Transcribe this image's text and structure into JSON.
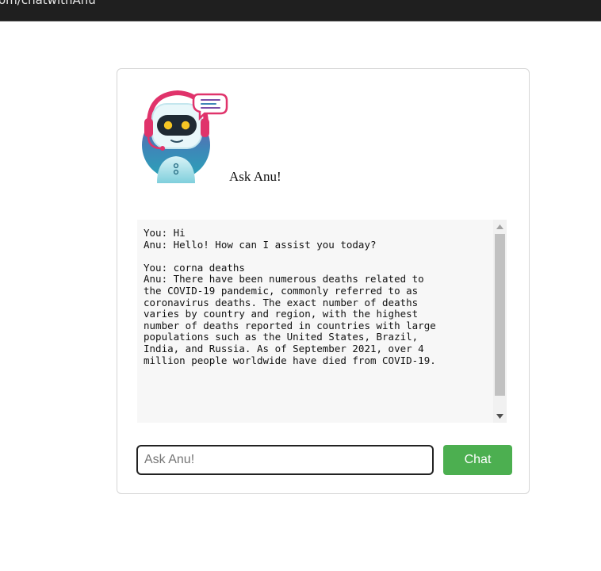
{
  "browser": {
    "url_fragment": "om/chatwithAnu"
  },
  "app": {
    "title": "Ask Anu!"
  },
  "chat": {
    "log": "You: Hi\nAnu: Hello! How can I assist you today?\n\nYou: corna deaths\nAnu: There have been numerous deaths related to\nthe COVID-19 pandemic, commonly referred to as\ncoronavirus deaths. The exact number of deaths\nvaries by country and region, with the highest\nnumber of deaths reported in countries with large\npopulations such as the United States, Brazil,\nIndia, and Russia. As of September 2021, over 4\nmillion people worldwide have died from COVID-19."
  },
  "input": {
    "placeholder": "Ask Anu!",
    "value": ""
  },
  "buttons": {
    "chat_label": "Chat"
  },
  "colors": {
    "accent": "#4caf50",
    "chat_bg": "#f7f7f7",
    "topbar_bg": "#1f1f1f"
  },
  "icons": {
    "logo": "robot-headset-icon",
    "scroll_up": "triangle-up-icon",
    "scroll_down": "triangle-down-icon"
  }
}
